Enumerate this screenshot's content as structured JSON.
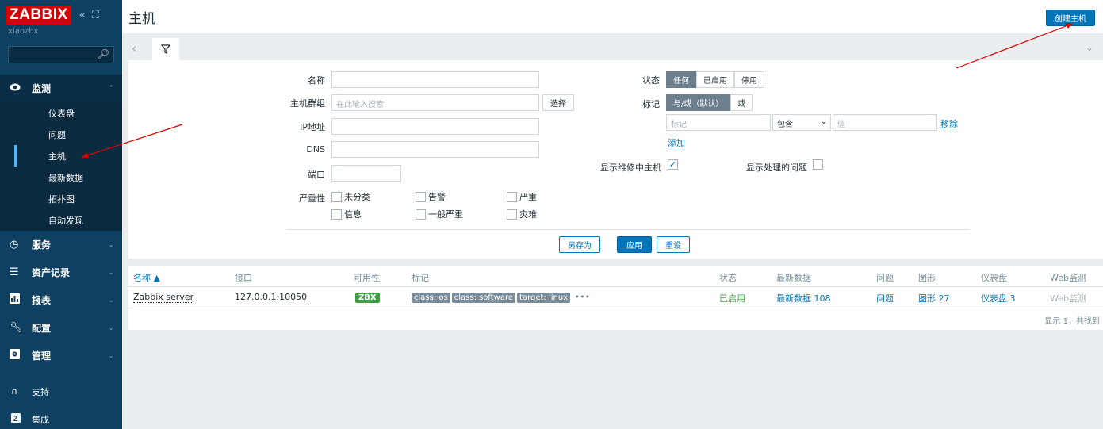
{
  "app": {
    "logo": "ZABBIX",
    "collapse_icon": "«",
    "kiosk_icon": "⛶",
    "server_name": "xiaozbx",
    "search_placeholder": ""
  },
  "sidebar": {
    "menu": [
      {
        "label": "监测",
        "icon": "eye-icon"
      },
      {
        "label": "服务",
        "icon": "clock-icon"
      },
      {
        "label": "资产记录",
        "icon": "list-icon"
      },
      {
        "label": "报表",
        "icon": "chart-icon"
      },
      {
        "label": "配置",
        "icon": "wrench-icon"
      },
      {
        "label": "管理",
        "icon": "gear-icon"
      }
    ],
    "monitoring_sub": [
      {
        "label": "仪表盘"
      },
      {
        "label": "问题"
      },
      {
        "label": "主机"
      },
      {
        "label": "最新数据"
      },
      {
        "label": "拓扑图"
      },
      {
        "label": "自动发现"
      }
    ],
    "bottom": [
      {
        "label": "支持"
      },
      {
        "label": "集成"
      }
    ]
  },
  "header": {
    "title": "主机",
    "create_button": "创建主机"
  },
  "filter": {
    "name_label": "名称",
    "name_value": "",
    "hostgroup_label": "主机群组",
    "hostgroup_placeholder": "在此输入搜索",
    "select_button": "选择",
    "ip_label": "IP地址",
    "dns_label": "DNS",
    "port_label": "端口",
    "severity_label": "严重性",
    "severities": [
      "未分类",
      "告警",
      "严重",
      "信息",
      "一般严重",
      "灾难"
    ],
    "status_label": "状态",
    "status_options": [
      "任何",
      "已启用",
      "停用"
    ],
    "status_selected": "任何",
    "tags_label": "标记",
    "tag_operators": [
      "与/或（默认）",
      "或"
    ],
    "tag_placeholder": "标记",
    "tag_condition": "包含",
    "tag_value_placeholder": "值",
    "remove_link": "移除",
    "add_link": "添加",
    "show_maintenance_label": "显示维修中主机",
    "show_maintenance_checked": true,
    "show_suppressed_label": "显示处理的问题",
    "show_suppressed_checked": false,
    "save_as_button": "另存为",
    "apply_button": "应用",
    "reset_button": "重设"
  },
  "table": {
    "headers": [
      "名称 ▲",
      "接口",
      "可用性",
      "标记",
      "状态",
      "最新数据",
      "问题",
      "图形",
      "仪表盘",
      "Web监测"
    ],
    "rows": [
      {
        "name": "Zabbix server",
        "interface": "127.0.0.1:10050",
        "availability": "ZBX",
        "tags": [
          "class: os",
          "class: software",
          "target: linux"
        ],
        "tags_more": "•••",
        "status": "已启用",
        "latest_data": "最新数据 108",
        "problems": "问题",
        "graphs": "图形 27",
        "dashboards": "仪表盘 3",
        "web": "Web监测"
      }
    ],
    "footer": "显示 1，共找到"
  }
}
